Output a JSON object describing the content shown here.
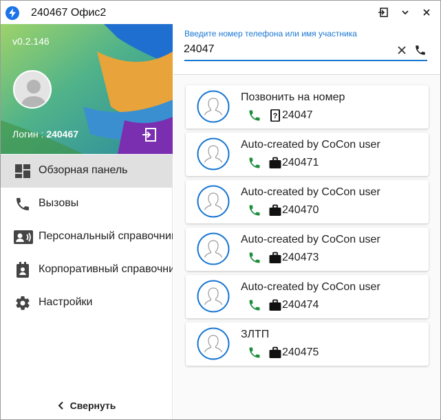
{
  "window": {
    "title": "240467 Офис2",
    "controls": [
      "restore-icon",
      "chevron-down-icon",
      "close-icon"
    ]
  },
  "sidebar": {
    "version": "v0.2.146",
    "login_label": "Логин : ",
    "login_value": "240467",
    "items": [
      {
        "label": "Обзорная панель",
        "icon": "dashboard-icon",
        "active": true
      },
      {
        "label": "Вызовы",
        "icon": "phone-icon",
        "active": false
      },
      {
        "label": "Персональный справочник",
        "icon": "contacts-icon",
        "active": false
      },
      {
        "label": "Корпоративный справочник",
        "icon": "corporate-directory-icon",
        "active": false
      },
      {
        "label": "Настройки",
        "icon": "settings-icon",
        "active": false
      }
    ],
    "collapse_label": "Свернуть"
  },
  "search": {
    "hint": "Введите номер телефона или имя участника",
    "value": "24047"
  },
  "results": [
    {
      "name": "Позвонить на номер",
      "type_icon": "unknown-number-icon",
      "number": "24047"
    },
    {
      "name": "Auto-created by CoCon user",
      "type_icon": "work-briefcase-icon",
      "number": "240471"
    },
    {
      "name": "Auto-created by CoCon user",
      "type_icon": "work-briefcase-icon",
      "number": "240470"
    },
    {
      "name": "Auto-created by CoCon user",
      "type_icon": "work-briefcase-icon",
      "number": "240473"
    },
    {
      "name": "Auto-created by CoCon user",
      "type_icon": "work-briefcase-icon",
      "number": "240474"
    },
    {
      "name": "ЗЛТП",
      "type_icon": "work-briefcase-icon",
      "number": "240475"
    }
  ],
  "colors": {
    "accent": "#1976d2",
    "call_green": "#1e8e3e",
    "active_nav": "#e0e0e0"
  }
}
